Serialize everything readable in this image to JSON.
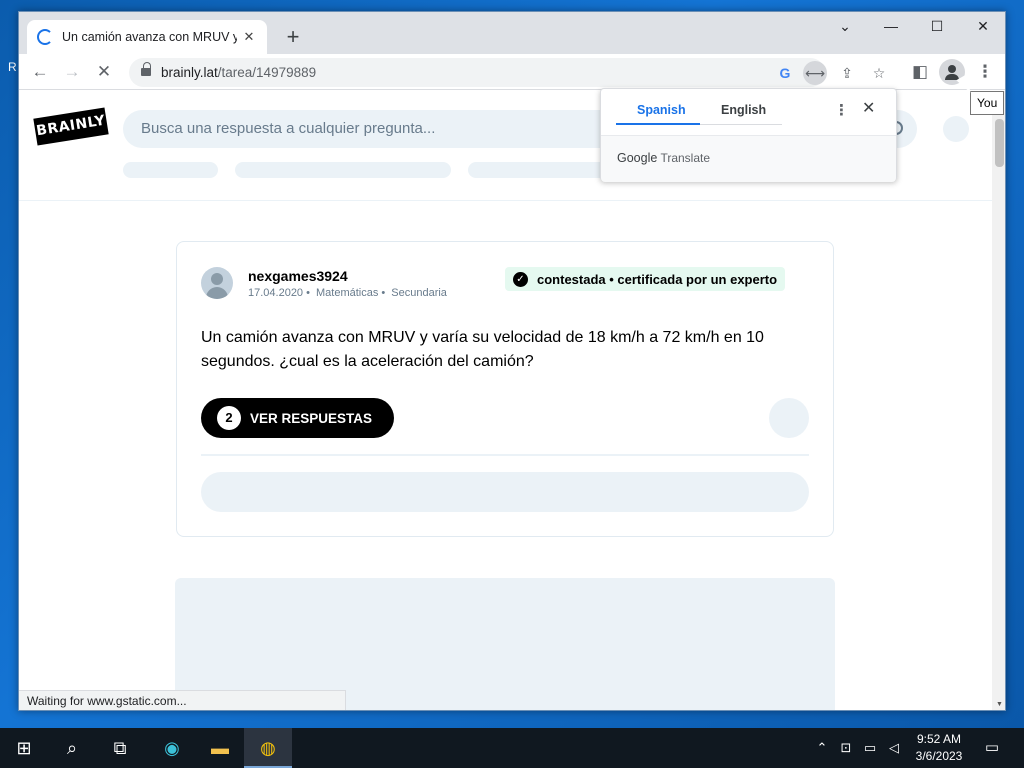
{
  "browser": {
    "tab_title": "Un camión avanza con MRUV y v",
    "url_host": "brainly.lat",
    "url_path": "/tarea/14979889",
    "status_text": "Waiting for www.gstatic.com...",
    "profile_tooltip": "You"
  },
  "site": {
    "logo_text": "BRAINLY",
    "search_placeholder": "Busca una respuesta a cualquier pregunta..."
  },
  "question": {
    "username": "nexgames3924",
    "date": "17.04.2020",
    "subject": "Matemáticas",
    "level": "Secundaria",
    "badge": "contestada • certificada por un experto",
    "text": "Un camión avanza con MRUV y varía su velocidad de 18 km/h a 72 km/h en 10 segundos. ¿cual es la aceleración del camión?",
    "answers_count": "2",
    "answers_label": "VER RESPUESTAS"
  },
  "translate_popup": {
    "source_lang": "Spanish",
    "target_lang": "English",
    "brand_google": "Google",
    "brand_translate": "Translate"
  },
  "taskbar": {
    "time": "9:52 AM",
    "date": "3/6/2023"
  },
  "colors": {
    "accent": "#1a73e8",
    "skeleton": "#ebf2f7",
    "badge_bg": "#e5f9f0"
  }
}
